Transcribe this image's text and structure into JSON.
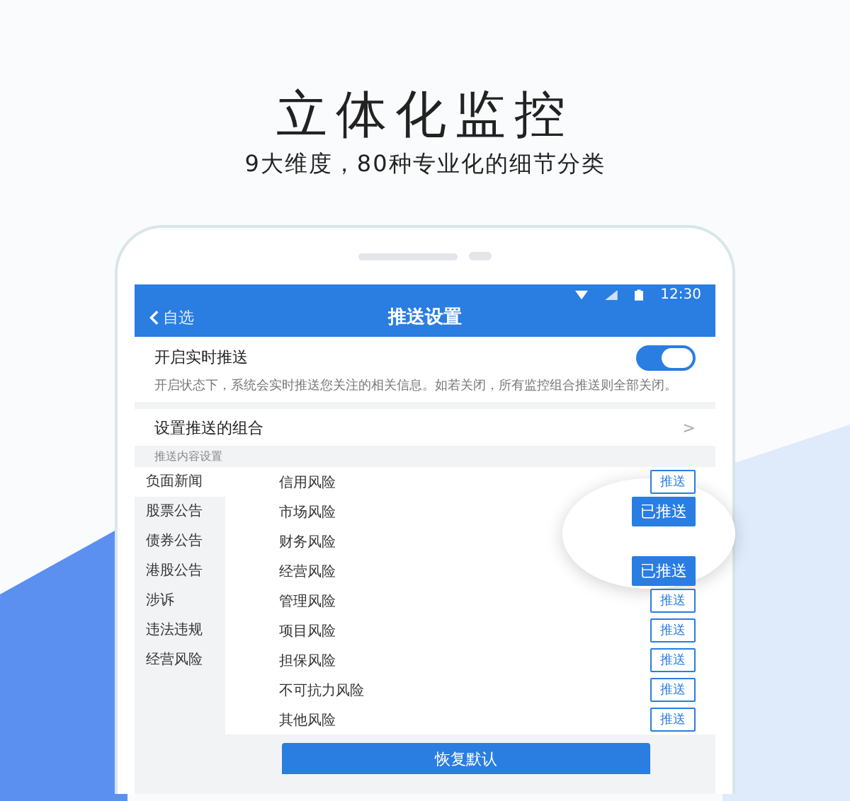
{
  "headline": "立体化监控",
  "subheadline": "9大维度，80种专业化的细节分类",
  "status_bar": {
    "time": "12:30"
  },
  "nav": {
    "back_label": "自选",
    "title": "推送设置"
  },
  "realtime_push": {
    "label": "开启实时推送",
    "on": true,
    "description": "开启状态下，系统会实时推送您关注的相关信息。如若关闭，所有监控组合推送则全部关闭。"
  },
  "combo_row": {
    "label": "设置推送的组合",
    "chevron": ">"
  },
  "section_label": "推送内容设置",
  "categories": [
    {
      "label": "负面新闻",
      "selected": true
    },
    {
      "label": "股票公告",
      "selected": false
    },
    {
      "label": "债券公告",
      "selected": false
    },
    {
      "label": "港股公告",
      "selected": false
    },
    {
      "label": "涉诉",
      "selected": false
    },
    {
      "label": "违法违规",
      "selected": false
    },
    {
      "label": "经营风险",
      "selected": false
    }
  ],
  "risks": [
    {
      "label": "信用风险",
      "button": "推送",
      "pushed": false
    },
    {
      "label": "市场风险",
      "button": "已推送",
      "pushed": true
    },
    {
      "label": "财务风险"
    },
    {
      "label": "经营风险",
      "button": "已推送",
      "pushed": true
    },
    {
      "label": "管理风险",
      "button": "推送",
      "pushed": false
    },
    {
      "label": "项目风险",
      "button": "推送",
      "pushed": false
    },
    {
      "label": "担保风险",
      "button": "推送",
      "pushed": false
    },
    {
      "label": "不可抗力风险",
      "button": "推送",
      "pushed": false
    },
    {
      "label": "其他风险",
      "button": "推送",
      "pushed": false
    }
  ],
  "restore_button": "恢复默认"
}
